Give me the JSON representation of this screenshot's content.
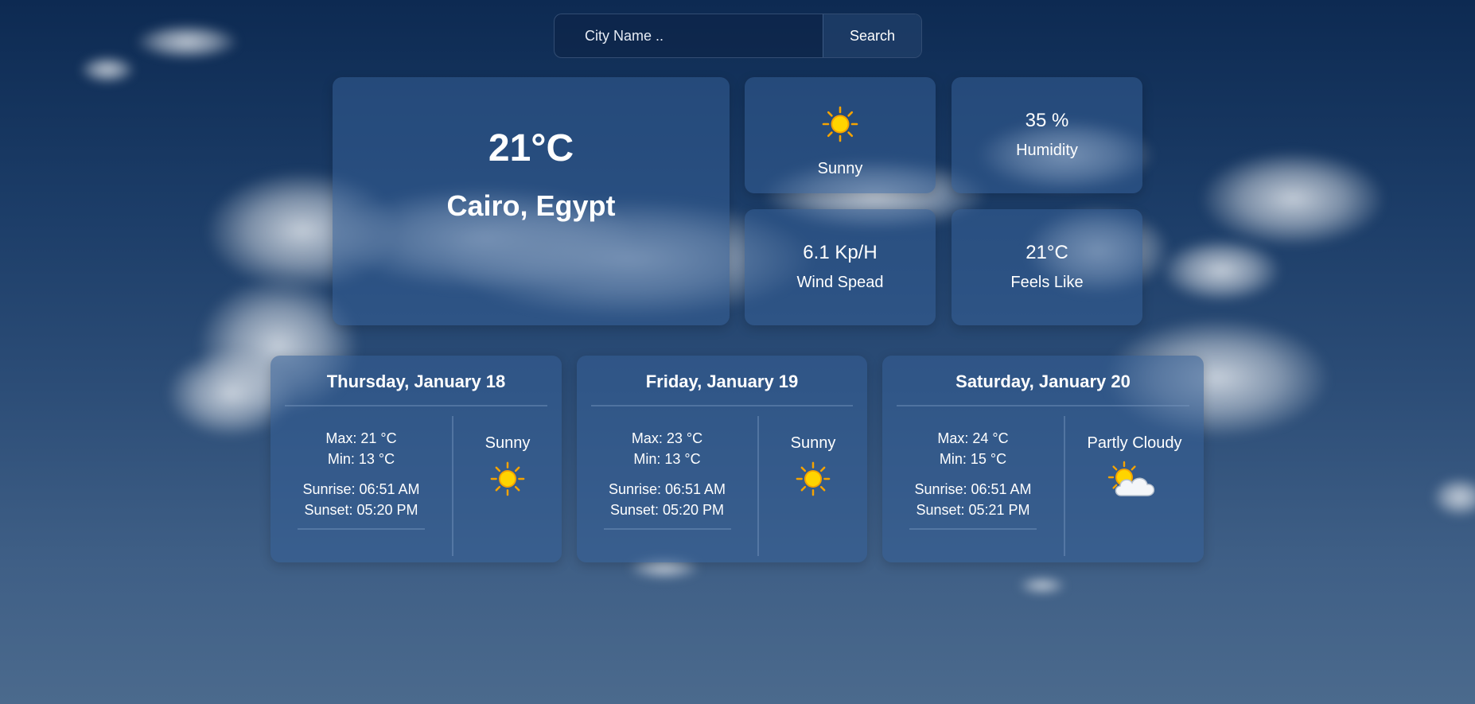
{
  "search": {
    "placeholder": "City Name ..",
    "value": "",
    "button_label": "Search"
  },
  "current": {
    "temperature": "21°C",
    "location": "Cairo, Egypt",
    "condition": "Sunny",
    "condition_icon": "sun-icon",
    "humidity_value": "35 %",
    "humidity_label": "Humidity",
    "wind_value": "6.1 Kp/H",
    "wind_label": "Wind Spead",
    "feels_value": "21°C",
    "feels_label": "Feels Like"
  },
  "forecast": [
    {
      "date": "Thursday, January 18",
      "max": "Max: 21 °C",
      "min": "Min: 13 °C",
      "sunrise": "Sunrise: 06:51 AM",
      "sunset": "Sunset: 05:20 PM",
      "condition": "Sunny",
      "icon": "sun-icon"
    },
    {
      "date": "Friday, January 19",
      "max": "Max: 23 °C",
      "min": "Min: 13 °C",
      "sunrise": "Sunrise: 06:51 AM",
      "sunset": "Sunset: 05:20 PM",
      "condition": "Sunny",
      "icon": "sun-icon"
    },
    {
      "date": "Saturday, January 20",
      "max": "Max: 24 °C",
      "min": "Min: 15 °C",
      "sunrise": "Sunrise: 06:51 AM",
      "sunset": "Sunset: 05:21 PM",
      "condition": "Partly Cloudy",
      "icon": "partly-cloudy-icon"
    }
  ],
  "colors": {
    "card_background": "#345e96",
    "text": "#ffffff",
    "sun_yellow": "#ffd400",
    "sun_orange": "#f5a300"
  }
}
